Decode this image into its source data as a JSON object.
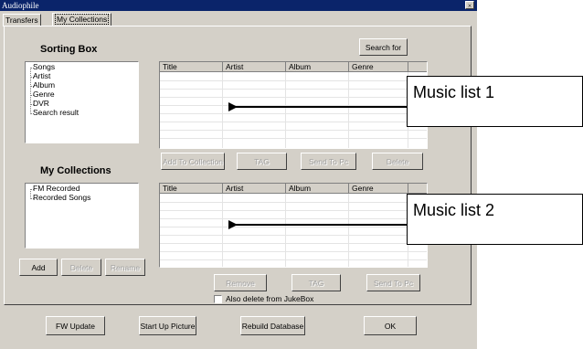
{
  "window": {
    "title": "Audiophile",
    "close_glyph": "×"
  },
  "tabs": [
    {
      "label": "Transfers"
    },
    {
      "label": "My Collections"
    }
  ],
  "sorting_box": {
    "heading": "Sorting Box",
    "items": [
      "Songs",
      "Artist",
      "Album",
      "Genre",
      "DVR",
      "Search result"
    ]
  },
  "search_button": "Search for",
  "music_list_1": {
    "columns": [
      "Title",
      "Artist",
      "Album",
      "Genre"
    ],
    "rows": []
  },
  "list1_actions": {
    "add_to_collection": "Add To Collection",
    "tag": "TAG",
    "send_to_pc": "Send To Pc",
    "delete": "Delete"
  },
  "my_collections": {
    "heading": "My Collections",
    "items": [
      "FM Recorded",
      "Recorded Songs"
    ]
  },
  "collection_actions": {
    "add": "Add",
    "delete": "Delete",
    "rename": "Rename"
  },
  "music_list_2": {
    "columns": [
      "Title",
      "Artist",
      "Album",
      "Genre"
    ],
    "rows": []
  },
  "list2_actions": {
    "remove": "Remove",
    "tag": "TAG",
    "send_to_pc": "Send To Pc"
  },
  "also_delete": {
    "label": "Also delete from JukeBox",
    "checked": false
  },
  "footer": {
    "fw_update": "FW Update",
    "start_up_picture": "Start Up Picture",
    "rebuild_database": "Rebuild Database",
    "ok": "OK"
  },
  "annotations": [
    {
      "label": "Music list 1"
    },
    {
      "label": "Music list 2"
    }
  ]
}
